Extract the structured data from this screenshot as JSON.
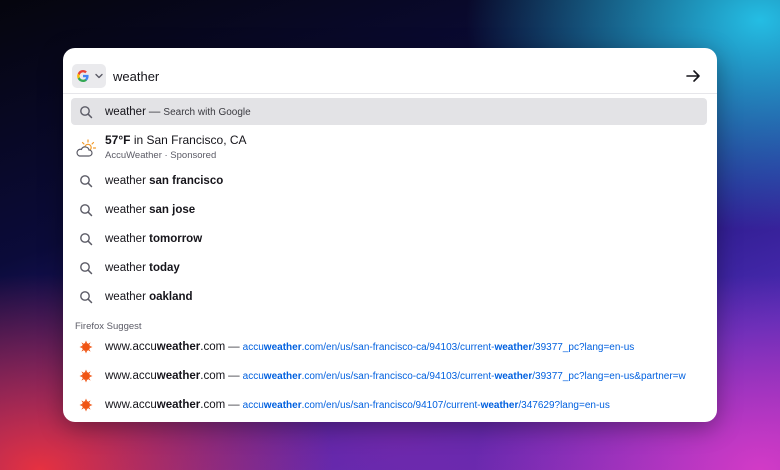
{
  "urlbar": {
    "engine_icon": "google-g-icon",
    "query": "weather",
    "go_icon": "arrow-right-icon"
  },
  "suggestions": {
    "search_row": {
      "term": "weather",
      "dash": "—",
      "action": "Search with Google"
    },
    "weather_card": {
      "icon": "partly-cloudy-icon",
      "temp": "57°F",
      "location": " in San Francisco, CA",
      "provider": "AccuWeather · Sponsored"
    },
    "items": [
      {
        "prefix": "weather ",
        "bold": "san francisco"
      },
      {
        "prefix": "weather ",
        "bold": "san jose"
      },
      {
        "prefix": "weather ",
        "bold": "tomorrow"
      },
      {
        "prefix": "weather ",
        "bold": "today"
      },
      {
        "prefix": "weather ",
        "bold": "oakland"
      }
    ]
  },
  "firefox_suggest": {
    "label": "Firefox Suggest",
    "rows": [
      {
        "site_prefix": "www.accu",
        "site_bold": "weather",
        "site_suffix": ".com",
        "dash": "—",
        "url_prefix": "accu",
        "url_bold": "weather",
        "url_mid": ".com/en/us/san-francisco-ca/94103/current-",
        "url_bold2": "weather",
        "url_suffix": "/39377_pc?lang=en-us"
      },
      {
        "site_prefix": "www.accu",
        "site_bold": "weather",
        "site_suffix": ".com",
        "dash": "—",
        "url_prefix": "accu",
        "url_bold": "weather",
        "url_mid": ".com/en/us/san-francisco-ca/94103/current-",
        "url_bold2": "weather",
        "url_suffix": "/39377_pc?lang=en-us&partner=w"
      },
      {
        "site_prefix": "www.accu",
        "site_bold": "weather",
        "site_suffix": ".com",
        "dash": "—",
        "url_prefix": "accu",
        "url_bold": "weather",
        "url_mid": ".com/en/us/san-francisco/94107/current-",
        "url_bold2": "weather",
        "url_suffix": "/347629?lang=en-us"
      }
    ]
  },
  "colors": {
    "link": "#0060df",
    "favicon": "#f05514",
    "selected_row": "#e3e3e6"
  }
}
